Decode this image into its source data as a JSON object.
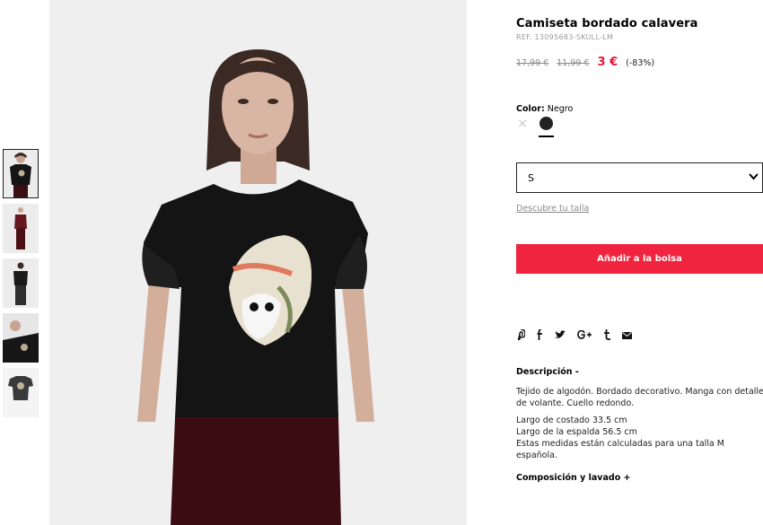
{
  "thumbnails": [
    {
      "name": "thumb-front"
    },
    {
      "name": "thumb-full-body"
    },
    {
      "name": "thumb-back"
    },
    {
      "name": "thumb-detail"
    },
    {
      "name": "thumb-flat"
    }
  ],
  "product": {
    "title": "Camiseta bordado calavera",
    "ref": "REF. 13095683-SKULL-LM",
    "price_original": "17,99 €",
    "price_previous": "11,99 €",
    "price_current": "3 €",
    "discount": "(-83%)",
    "color_label": "Color:",
    "color_value": "Negro",
    "size_selected": "S",
    "size_guide_link": "Descubre tu talla",
    "add_to_bag": "Añadir a la bolsa",
    "accent_color": "#f0243e"
  },
  "social": [
    {
      "icon": "pinterest-icon",
      "glyph": "P"
    },
    {
      "icon": "facebook-icon",
      "glyph": "f"
    },
    {
      "icon": "twitter-icon",
      "glyph": "🐦"
    },
    {
      "icon": "googleplus-icon",
      "glyph": "G+"
    },
    {
      "icon": "tumblr-icon",
      "glyph": "t"
    },
    {
      "icon": "email-icon",
      "glyph": "✉"
    }
  ],
  "description": {
    "heading": "Descripción -",
    "p1": "Tejido de algodón. Bordado decorativo. Manga con detalle de volante. Cuello redondo.",
    "line1": "Largo de costado 33.5 cm",
    "line2": "Largo de la espalda 56.5 cm",
    "line3": "Estas medidas están calculadas para una talla M española."
  },
  "composition": {
    "heading": "Composición y lavado +"
  }
}
